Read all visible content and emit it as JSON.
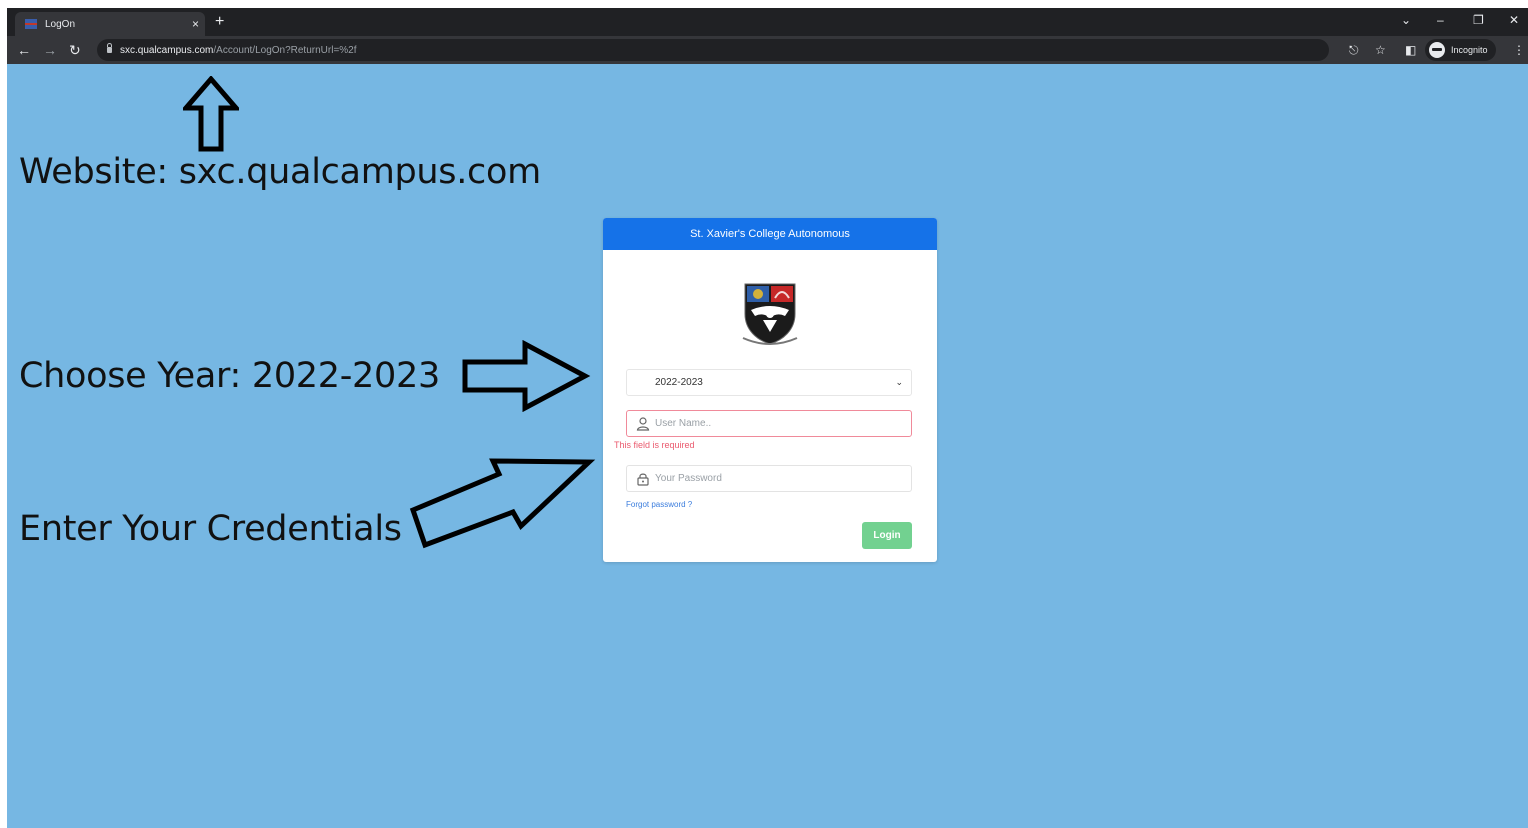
{
  "browser": {
    "tab_title": "LogOn",
    "tab_close": "×",
    "new_tab": "+",
    "url_host": "sxc.qualcampus.com",
    "url_path": "/Account/LogOn?ReturnUrl=%2f",
    "incognito_label": "Incognito",
    "icons": [
      "back-icon",
      "forward-icon",
      "reload-icon",
      "lock-icon",
      "key-icon",
      "star-icon",
      "side-panel-icon",
      "incognito-icon",
      "menu-icon"
    ]
  },
  "annotations": {
    "website": "Website: sxc.qualcampus.com",
    "year": "Choose Year: 2022-2023",
    "credentials": "Enter Your Credentials"
  },
  "login": {
    "header": "St. Xavier's College Autonomous",
    "year_selected": "2022-2023",
    "username_placeholder": "User Name..",
    "username_error": "This field is required",
    "password_placeholder": "Your Password",
    "forgot_password": "Forgot password ?",
    "login_button": "Login"
  },
  "colors": {
    "page_background": "#76b7e3",
    "card_header": "#1572e8",
    "login_button": "#72d190",
    "error": "#ea5a6e",
    "link": "#3b7ddd"
  }
}
